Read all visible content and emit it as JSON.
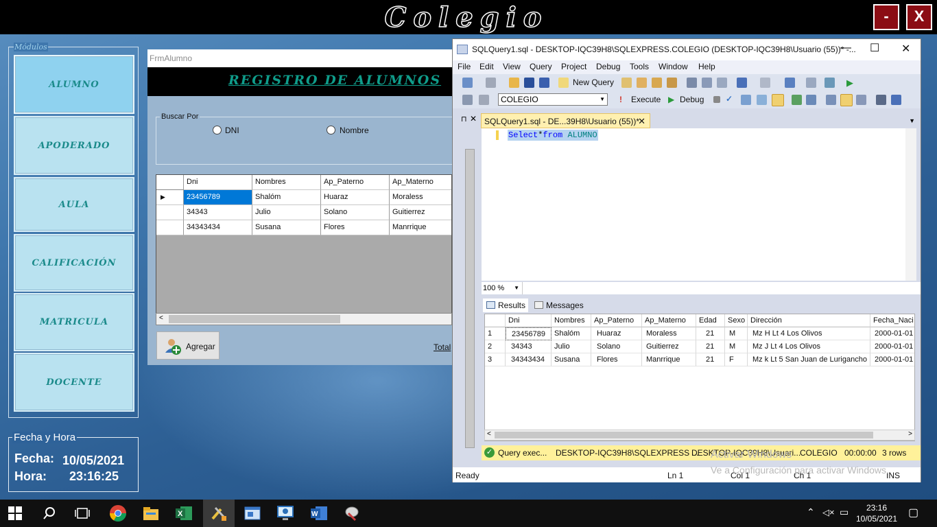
{
  "app": {
    "title": "Colegio",
    "minimize_label": "-",
    "close_label": "X"
  },
  "modules": {
    "legend": "Módulos",
    "items": [
      {
        "label": "ALUMNO"
      },
      {
        "label": "APODERADO"
      },
      {
        "label": "AULA"
      },
      {
        "label": "CALIFICACIÓN"
      },
      {
        "label": "MATRICULA"
      },
      {
        "label": "DOCENTE"
      }
    ]
  },
  "fecha_hora": {
    "legend": "Fecha y Hora",
    "fecha_label": "Fecha:",
    "fecha_value": "10/05/2021",
    "hora_label": "Hora:",
    "hora_value": "23:16:25"
  },
  "frm_alumno": {
    "caption": "FrmAlumno",
    "header": "REGISTRO DE ALUMNOS",
    "buscar_por": "Buscar Por",
    "radio_dni": "DNI",
    "radio_nombre": "Nombre",
    "columns": [
      "Dni",
      "Nombres",
      "Ap_Paterno",
      "Ap_Materno"
    ],
    "rows": [
      [
        "23456789",
        "Shalóm",
        "Huaraz",
        "Moraless"
      ],
      [
        "34343",
        "Julio",
        "Solano",
        "Guitierrez"
      ],
      [
        "34343434",
        "Susana",
        "Flores",
        "Manrrique"
      ]
    ],
    "row_indicator": "▶",
    "agregar_label": "Agregar",
    "total_label": "Total"
  },
  "ssms": {
    "title": "SQLQuery1.sql - DESKTOP-IQC39H8\\SQLEXPRESS.COLEGIO (DESKTOP-IQC39H8\\Usuario (55))* -...",
    "menu": [
      "File",
      "Edit",
      "View",
      "Query",
      "Project",
      "Debug",
      "Tools",
      "Window",
      "Help"
    ],
    "new_query_label": "New Query",
    "database": "COLEGIO",
    "execute_label": "Execute",
    "debug_label": "Debug",
    "tab_label": "SQLQuery1.sql - DE...39H8\\Usuario (55))*",
    "query_kw1": "Select",
    "query_star": "*",
    "query_kw2": "from",
    "query_table": "ALUMNO",
    "zoom": "100 %",
    "results_tab": "Results",
    "messages_tab": "Messages",
    "result_columns": [
      "Dni",
      "Nombres",
      "Ap_Paterno",
      "Ap_Materno",
      "Edad",
      "Sexo",
      "Dirección",
      "Fecha_Naci"
    ],
    "result_rows": [
      [
        "1",
        "23456789",
        "Shalóm",
        "Huaraz",
        "Moraless",
        "21",
        "M",
        "Mz H Lt 4 Los Olivos",
        "2000-01-01"
      ],
      [
        "2",
        "34343",
        "Julio",
        "Solano",
        "Guitierrez",
        "21",
        "M",
        "Mz J Lt 4 Los Olivos",
        "2000-01-01"
      ],
      [
        "3",
        "34343434",
        "Susana",
        "Flores",
        "Manrrique",
        "21",
        "F",
        "Mz k Lt 5 San Juan de Lurigancho",
        "2000-01-01"
      ]
    ],
    "status": {
      "query": "Query  exec...",
      "server": "DESKTOP-IQC39H8\\SQLEXPRESS ...",
      "user": "DESKTOP-IQC39H8\\Usuari...",
      "db": "COLEGIO",
      "time": "00:00:00",
      "rows": "3 rows"
    },
    "bottom": {
      "ready": "Ready",
      "ln": "Ln 1",
      "col": "Col 1",
      "ch": "Ch 1",
      "ins": "INS"
    }
  },
  "watermark": {
    "line1": "Activar Windows",
    "line2": "Ve a Configuración para activar Windows."
  },
  "taskbar": {
    "time": "23:16",
    "date": "10/05/2021"
  }
}
